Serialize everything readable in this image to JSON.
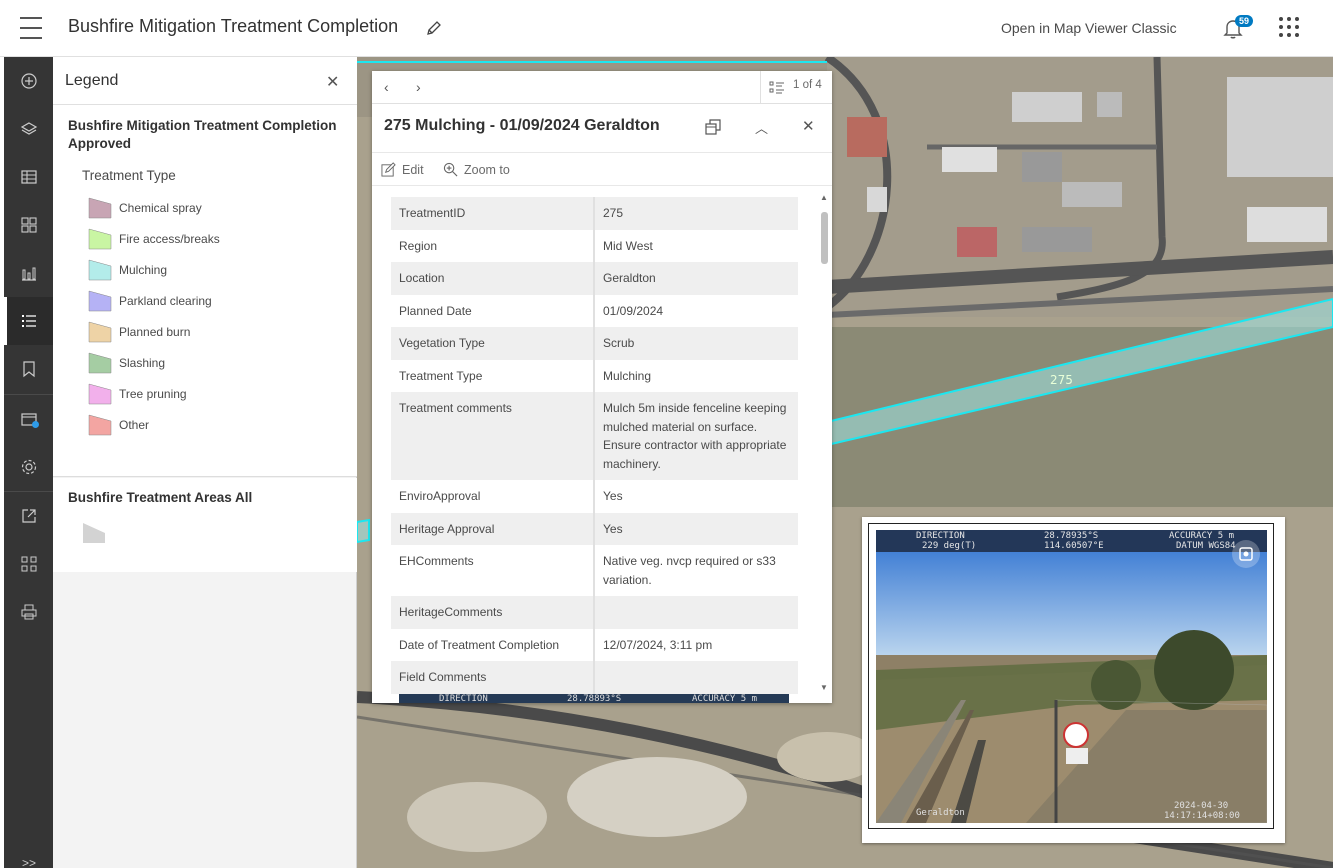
{
  "header": {
    "title": "Bushfire Mitigation Treatment Completion",
    "open_classic": "Open in Map Viewer Classic",
    "notifications": "59"
  },
  "rail": {
    "icons": [
      "add-layer-icon",
      "layers-icon",
      "table-icon",
      "basemap-icon",
      "charts-icon",
      "legend-icon",
      "bookmark-icon",
      "map-properties-icon",
      "settings-icon",
      "share-icon",
      "apps-icon",
      "print-icon"
    ],
    "expand": ">>"
  },
  "legend": {
    "title": "Legend",
    "layer1": {
      "title": "Bushfire Mitigation Treatment Completion Approved",
      "field": "Treatment Type",
      "items": [
        {
          "label": "Chemical spray",
          "color": "#c8a5b4"
        },
        {
          "label": "Fire access/breaks",
          "color": "#c9f5a3"
        },
        {
          "label": "Mulching",
          "color": "#b3ecea"
        },
        {
          "label": "Parkland clearing",
          "color": "#b5b2f5"
        },
        {
          "label": "Planned burn",
          "color": "#eed3a6"
        },
        {
          "label": "Slashing",
          "color": "#a5cda3"
        },
        {
          "label": "Tree pruning",
          "color": "#f2b0eb"
        },
        {
          "label": "Other",
          "color": "#f3a5a2"
        }
      ]
    },
    "layer2": {
      "title": "Bushfire Treatment Areas All",
      "color": "#d3d3d3"
    }
  },
  "popup": {
    "counter": "1 of 4",
    "title": "275 Mulching - 01/09/2024 Geraldton",
    "edit": "Edit",
    "zoom": "Zoom to",
    "rows": [
      {
        "k": "TreatmentID",
        "v": "275"
      },
      {
        "k": "Region",
        "v": "Mid West"
      },
      {
        "k": "Location",
        "v": "Geraldton"
      },
      {
        "k": "Planned Date",
        "v": "01/09/2024"
      },
      {
        "k": "Vegetation Type",
        "v": "Scrub"
      },
      {
        "k": "Treatment Type",
        "v": "Mulching"
      },
      {
        "k": "Treatment comments",
        "v": "Mulch 5m inside fenceline keeping mulched material on surface. Ensure contractor with appropriate machinery."
      },
      {
        "k": "EnviroApproval",
        "v": "Yes"
      },
      {
        "k": "Heritage Approval",
        "v": "Yes"
      },
      {
        "k": "EHComments",
        "v": "Native veg. nvcp required or s33 variation."
      },
      {
        "k": "HeritageComments",
        "v": ""
      },
      {
        "k": "Date of Treatment Completion",
        "v": "12/07/2024, 3:11 pm"
      },
      {
        "k": "Field Comments",
        "v": ""
      }
    ],
    "strip": {
      "a": "DIRECTION",
      "b": "28.78893°S",
      "c": "ACCURACY 5 m"
    }
  },
  "map": {
    "feature_label": "275",
    "photo": {
      "direction_label": "DIRECTION",
      "direction_value": "229 deg(T)",
      "lat": "28.78935°S",
      "lon": "114.60507°E",
      "accuracy": "ACCURACY 5 m",
      "datum": "DATUM WGS84",
      "place": "Geraldton",
      "date": "2024-04-30",
      "time": "14:17:14+08:00"
    }
  }
}
